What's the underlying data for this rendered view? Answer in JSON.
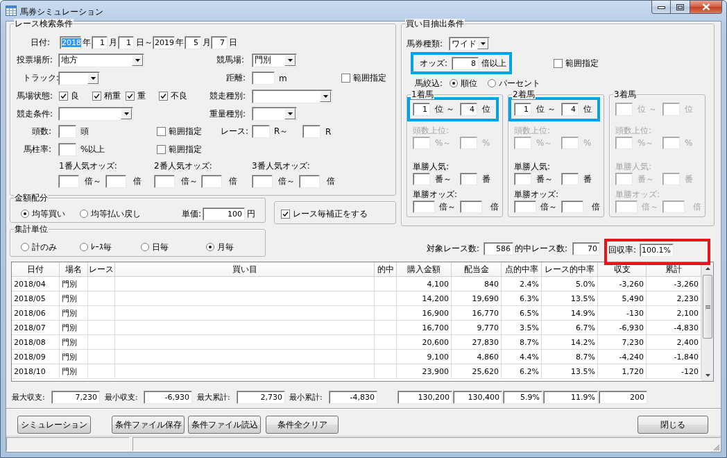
{
  "window": {
    "title": "馬券シミュレーション"
  },
  "race_search": {
    "title": "レース検索条件",
    "rows": [
      {
        "items": [
          {
            "kind": "label",
            "text": "日付:"
          },
          {
            "kind": "field",
            "value": "2018",
            "selected": true
          },
          {
            "kind": "label",
            "text": "年"
          },
          {
            "kind": "field",
            "value": "1",
            "selected": false
          },
          {
            "kind": "label",
            "text": "月"
          },
          {
            "kind": "field",
            "value": "1",
            "selected": false
          },
          {
            "kind": "label",
            "text": "日～"
          },
          {
            "kind": "field",
            "value": "2019",
            "selected": false
          },
          {
            "kind": "label",
            "text": "年"
          },
          {
            "kind": "field",
            "value": "5",
            "selected": false
          },
          {
            "kind": "label",
            "text": "月"
          },
          {
            "kind": "field",
            "value": "7",
            "selected": false
          },
          {
            "kind": "label",
            "text": "日"
          }
        ]
      },
      {
        "items": [
          {
            "kind": "label",
            "text": "投票場所:"
          },
          {
            "kind": "combo",
            "value": "地方"
          },
          {
            "kind": "label",
            "text": "競馬場:"
          },
          {
            "kind": "combo",
            "value": "門別"
          }
        ]
      },
      {
        "items": [
          {
            "kind": "label",
            "text": "トラック:"
          },
          {
            "kind": "combo"
          },
          {
            "kind": "label",
            "text": "距離:"
          },
          {
            "kind": "field"
          },
          {
            "kind": "label",
            "text": "m"
          },
          {
            "kind": "check",
            "text": "範囲指定",
            "checked": false
          }
        ]
      },
      {
        "items": [
          {
            "kind": "label",
            "text": "馬場状態:"
          },
          {
            "kind": "check",
            "text": "良",
            "checked": true
          },
          {
            "kind": "check",
            "text": "稍重",
            "checked": true
          },
          {
            "kind": "check",
            "text": "重",
            "checked": true
          },
          {
            "kind": "check",
            "text": "不良",
            "checked": true
          },
          {
            "kind": "label",
            "text": "競走種別:"
          },
          {
            "kind": "combo"
          }
        ]
      },
      {
        "items": [
          {
            "kind": "label",
            "text": "競走条件:"
          },
          {
            "kind": "combo"
          },
          {
            "kind": "label",
            "text": "重量種別:"
          },
          {
            "kind": "combo"
          }
        ]
      },
      {
        "items": [
          {
            "kind": "label",
            "text": "頭数:"
          },
          {
            "kind": "field"
          },
          {
            "kind": "label",
            "text": "頭"
          },
          {
            "kind": "check",
            "text": "範囲指定",
            "checked": false
          },
          {
            "kind": "label",
            "text": "レース:"
          },
          {
            "kind": "field"
          },
          {
            "kind": "label",
            "text": "R～"
          },
          {
            "kind": "field"
          },
          {
            "kind": "label",
            "text": "R"
          }
        ]
      },
      {
        "items": [
          {
            "kind": "label",
            "text": "馬柱率:"
          },
          {
            "kind": "field"
          },
          {
            "kind": "label",
            "text": "%以上"
          },
          {
            "kind": "check",
            "text": "範囲指定",
            "checked": false
          }
        ]
      },
      {
        "items": [
          {
            "kind": "label",
            "text": "1番人気オッズ:"
          },
          {
            "kind": "label",
            "text": "2番人気オッズ:"
          },
          {
            "kind": "label",
            "text": "3番人気オッズ:"
          }
        ]
      },
      {
        "items": [
          {
            "kind": "field"
          },
          {
            "kind": "label",
            "text": "倍～"
          },
          {
            "kind": "field"
          },
          {
            "kind": "label",
            "text": "倍"
          },
          {
            "kind": "field"
          },
          {
            "kind": "label",
            "text": "倍～"
          },
          {
            "kind": "field"
          },
          {
            "kind": "label",
            "text": "倍"
          },
          {
            "kind": "field"
          },
          {
            "kind": "label",
            "text": "倍～"
          },
          {
            "kind": "field"
          },
          {
            "kind": "label",
            "text": "倍"
          }
        ]
      }
    ]
  },
  "buy_conditions": {
    "title": "買い目抽出条件",
    "ticket_type": [
      {
        "kind": "label",
        "text": "馬券種類:"
      },
      {
        "kind": "combo",
        "value": "ワイド"
      }
    ],
    "odds": {
      "highlighted": true,
      "items": [
        {
          "kind": "label",
          "text": "オッズ:"
        },
        {
          "kind": "field",
          "value": "8"
        },
        {
          "kind": "label",
          "text": "倍以上"
        }
      ]
    },
    "odds_range": {
      "kind": "check",
      "text": "範囲指定",
      "checked": false
    },
    "filter": [
      {
        "kind": "label",
        "text": "馬絞込:"
      },
      {
        "kind": "radio",
        "text": "順位",
        "selected": true
      },
      {
        "kind": "radio",
        "text": "パーセント",
        "selected": false
      }
    ],
    "placings": [
      {
        "title": "1着馬",
        "highlighted": true,
        "rows": [
          {
            "items": [
              {
                "kind": "field",
                "value": "1",
                "disabled": false
              },
              {
                "kind": "label",
                "text": "位 ～",
                "disabled": false
              },
              {
                "kind": "field",
                "value": "4",
                "disabled": false
              },
              {
                "kind": "label",
                "text": "位",
                "disabled": false
              }
            ]
          },
          {
            "items": [
              {
                "kind": "label",
                "text": "頭数上位:",
                "disabled": true
              }
            ]
          },
          {
            "items": [
              {
                "kind": "field",
                "disabled": true
              },
              {
                "kind": "label",
                "text": "%～",
                "disabled": true
              },
              {
                "kind": "field",
                "disabled": true
              },
              {
                "kind": "label",
                "text": "%",
                "disabled": true
              }
            ]
          },
          {
            "items": [
              {
                "kind": "label",
                "text": "単勝人気:",
                "disabled": false
              }
            ]
          },
          {
            "items": [
              {
                "kind": "field",
                "disabled": false
              },
              {
                "kind": "label",
                "text": "番～",
                "disabled": false
              },
              {
                "kind": "field",
                "disabled": false
              },
              {
                "kind": "label",
                "text": "番",
                "disabled": false
              }
            ]
          },
          {
            "items": [
              {
                "kind": "label",
                "text": "単勝オッズ:",
                "disabled": false
              }
            ]
          },
          {
            "items": [
              {
                "kind": "field",
                "disabled": false
              },
              {
                "kind": "label",
                "text": "倍～",
                "disabled": false
              },
              {
                "kind": "field",
                "disabled": false
              },
              {
                "kind": "label",
                "text": "倍",
                "disabled": false
              }
            ]
          }
        ]
      },
      {
        "title": "2着馬",
        "highlighted": true,
        "rows": [
          {
            "items": [
              {
                "kind": "field",
                "value": "1",
                "disabled": false
              },
              {
                "kind": "label",
                "text": "位 ～",
                "disabled": false
              },
              {
                "kind": "field",
                "value": "4",
                "disabled": false
              },
              {
                "kind": "label",
                "text": "位",
                "disabled": false
              }
            ]
          },
          {
            "items": [
              {
                "kind": "label",
                "text": "頭数上位:",
                "disabled": true
              }
            ]
          },
          {
            "items": [
              {
                "kind": "field",
                "disabled": true
              },
              {
                "kind": "label",
                "text": "%～",
                "disabled": true
              },
              {
                "kind": "field",
                "disabled": true
              },
              {
                "kind": "label",
                "text": "%",
                "disabled": true
              }
            ]
          },
          {
            "items": [
              {
                "kind": "label",
                "text": "単勝人気:",
                "disabled": false
              }
            ]
          },
          {
            "items": [
              {
                "kind": "field",
                "disabled": false
              },
              {
                "kind": "label",
                "text": "番～",
                "disabled": false
              },
              {
                "kind": "field",
                "disabled": false
              },
              {
                "kind": "label",
                "text": "番",
                "disabled": false
              }
            ]
          },
          {
            "items": [
              {
                "kind": "label",
                "text": "単勝オッズ:",
                "disabled": false
              }
            ]
          },
          {
            "items": [
              {
                "kind": "field",
                "disabled": false
              },
              {
                "kind": "label",
                "text": "倍～",
                "disabled": false
              },
              {
                "kind": "field",
                "disabled": false
              },
              {
                "kind": "label",
                "text": "倍",
                "disabled": false
              }
            ]
          }
        ]
      },
      {
        "title": "3着馬",
        "highlighted": false,
        "rows": [
          {
            "items": [
              {
                "kind": "field",
                "disabled": true
              },
              {
                "kind": "label",
                "text": "位 ～",
                "disabled": true
              },
              {
                "kind": "field",
                "disabled": true
              },
              {
                "kind": "label",
                "text": "位",
                "disabled": true
              }
            ]
          },
          {
            "items": [
              {
                "kind": "label",
                "text": "頭数上位:",
                "disabled": true
              }
            ]
          },
          {
            "items": [
              {
                "kind": "field",
                "disabled": true
              },
              {
                "kind": "label",
                "text": "%～",
                "disabled": true
              },
              {
                "kind": "field",
                "disabled": true
              },
              {
                "kind": "label",
                "text": "%",
                "disabled": true
              }
            ]
          },
          {
            "items": [
              {
                "kind": "label",
                "text": "単勝人気:",
                "disabled": true
              }
            ]
          },
          {
            "items": [
              {
                "kind": "field",
                "disabled": true
              },
              {
                "kind": "label",
                "text": "番～",
                "disabled": true
              },
              {
                "kind": "field",
                "disabled": true
              },
              {
                "kind": "label",
                "text": "番",
                "disabled": true
              }
            ]
          },
          {
            "items": [
              {
                "kind": "label",
                "text": "単勝オッズ:",
                "disabled": true
              }
            ]
          },
          {
            "items": [
              {
                "kind": "field",
                "disabled": true
              },
              {
                "kind": "label",
                "text": "倍～",
                "disabled": true
              },
              {
                "kind": "field",
                "disabled": true
              },
              {
                "kind": "label",
                "text": "倍",
                "disabled": true
              }
            ]
          }
        ]
      }
    ]
  },
  "amount_allocation": {
    "title": "金額配分",
    "items": [
      {
        "kind": "radio",
        "text": "均等買い",
        "selected": true
      },
      {
        "kind": "radio",
        "text": "均等払い戻し",
        "selected": false
      },
      {
        "kind": "label",
        "text": "単価:"
      },
      {
        "kind": "field",
        "value": "100"
      },
      {
        "kind": "label",
        "text": "円"
      }
    ]
  },
  "race_correction": {
    "kind": "check",
    "text": "レース毎補正をする",
    "checked": true
  },
  "aggregation": {
    "title": "集計単位",
    "options": [
      {
        "kind": "radio",
        "text": "計のみ",
        "selected": false
      },
      {
        "kind": "radio",
        "text": "ﾚｰｽ毎",
        "selected": false
      },
      {
        "kind": "radio",
        "text": "日毎",
        "selected": false
      },
      {
        "kind": "radio",
        "text": "月毎",
        "selected": true
      }
    ]
  },
  "counts": [
    {
      "label": "対象レース数:",
      "value": "586"
    },
    {
      "label": "的中レース数:",
      "value": "70"
    },
    {
      "label": "回収率:",
      "value": "100.1%",
      "highlighted": true
    }
  ],
  "table": {
    "columns": [
      "日付",
      "場名",
      "レース",
      "買い目",
      "的中",
      "購入金額",
      "配当金",
      "点的中率",
      "レース的中率",
      "収支",
      "累計"
    ],
    "rows": [
      {
        "date": "2018/04",
        "venue": "門別",
        "purchase": "4,100",
        "payout": "840",
        "point_hit_rate": "2.4%",
        "race_hit_rate": "5.0%",
        "balance": "-3,260",
        "cumulative": "-3,260"
      },
      {
        "date": "2018/05",
        "venue": "門別",
        "purchase": "14,200",
        "payout": "19,690",
        "point_hit_rate": "6.3%",
        "race_hit_rate": "13.5%",
        "balance": "5,490",
        "cumulative": "2,230"
      },
      {
        "date": "2018/06",
        "venue": "門別",
        "purchase": "16,900",
        "payout": "16,770",
        "point_hit_rate": "6.5%",
        "race_hit_rate": "14.9%",
        "balance": "-130",
        "cumulative": "2,100"
      },
      {
        "date": "2018/07",
        "venue": "門別",
        "purchase": "16,700",
        "payout": "9,770",
        "point_hit_rate": "3.5%",
        "race_hit_rate": "6.7%",
        "balance": "-6,930",
        "cumulative": "-4,830"
      },
      {
        "date": "2018/08",
        "venue": "門別",
        "purchase": "20,600",
        "payout": "27,830",
        "point_hit_rate": "8.7%",
        "race_hit_rate": "14.2%",
        "balance": "7,230",
        "cumulative": "2,400"
      },
      {
        "date": "2018/09",
        "venue": "門別",
        "purchase": "9,100",
        "payout": "4,860",
        "point_hit_rate": "4.4%",
        "race_hit_rate": "8.7%",
        "balance": "-4,240",
        "cumulative": "-1,840"
      },
      {
        "date": "2018/10",
        "venue": "門別",
        "purchase": "23,900",
        "payout": "25,620",
        "point_hit_rate": "6.2%",
        "race_hit_rate": "13.5%",
        "balance": "1,720",
        "cumulative": "-120"
      }
    ]
  },
  "summary": {
    "stats": [
      {
        "label": "最大収支:",
        "value": "7,230"
      },
      {
        "label": "最小収支:",
        "value": "-6,930"
      },
      {
        "label": "最大累計:",
        "value": "2,730"
      },
      {
        "label": "最小累計:",
        "value": "-4,830"
      }
    ],
    "totals": [
      "130,200",
      "130,400",
      "5.9%",
      "11.9%",
      "200"
    ]
  },
  "buttons": [
    "シミュレーション",
    "条件ファイル保存",
    "条件ファイル読込",
    "条件全クリア"
  ],
  "close_button": "閉じる"
}
